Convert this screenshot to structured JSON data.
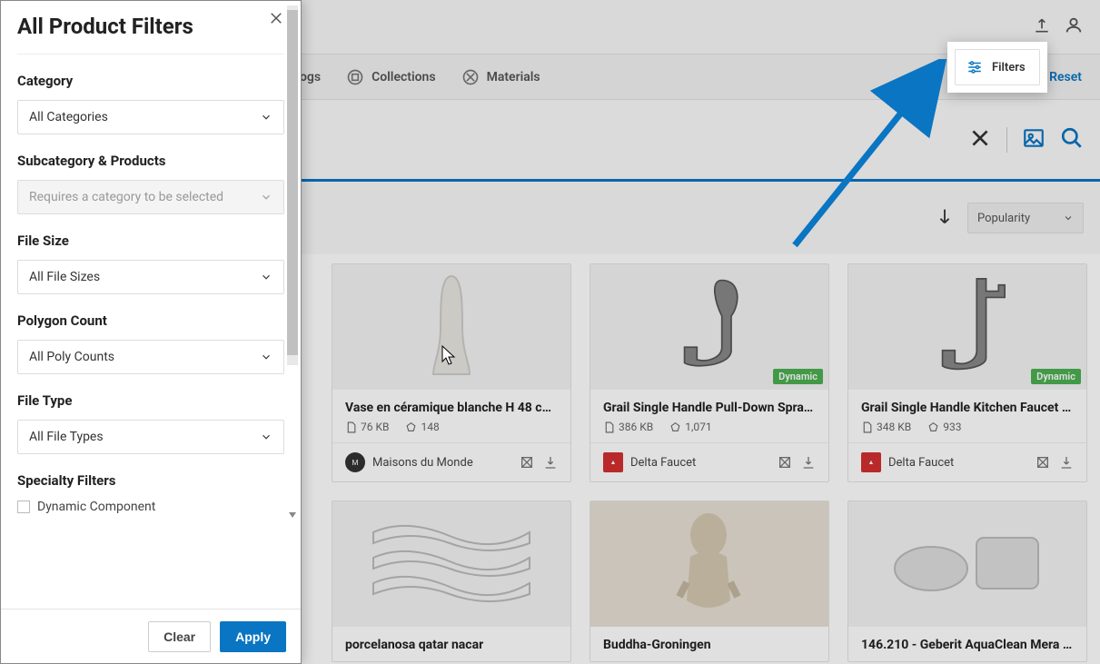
{
  "topbar": {},
  "tabs": {
    "catalogs_label": "ogs",
    "collections_label": "Collections",
    "materials_label": "Materials"
  },
  "reset_label": "Reset",
  "filters_button_label": "Filters",
  "sort": {
    "label": "Popularity"
  },
  "cards": [
    {
      "title": "Vase en céramique blanche H 48 cm …",
      "size": "76 KB",
      "poly": "148",
      "brand": "Maisons du Monde",
      "brand_kind": "round",
      "dynamic": false
    },
    {
      "title": "Grail Single Handle Pull-Down Spray …",
      "size": "386 KB",
      "poly": "1,071",
      "brand": "Delta Faucet",
      "brand_kind": "delta",
      "dynamic": true
    },
    {
      "title": "Grail Single Handle Kitchen Faucet b…",
      "size": "348 KB",
      "poly": "933",
      "brand": "Delta Faucet",
      "brand_kind": "delta",
      "dynamic": true
    }
  ],
  "cards_row2": [
    {
      "title": "porcelanosa qatar nacar"
    },
    {
      "title": "Buddha-Groningen"
    },
    {
      "title": "146.210 - Geberit AquaClean Mera Co…"
    }
  ],
  "badge_label": "Dynamic",
  "sidebar": {
    "title": "All Product Filters",
    "category_label": "Category",
    "category_value": "All Categories",
    "subcategory_label": "Subcategory & Products",
    "subcategory_placeholder": "Requires a category to be selected",
    "filesize_label": "File Size",
    "filesize_value": "All File Sizes",
    "polycount_label": "Polygon Count",
    "polycount_value": "All Poly Counts",
    "filetype_label": "File Type",
    "filetype_value": "All File Types",
    "specialty_label": "Specialty Filters",
    "dynamic_component_label": "Dynamic Component",
    "clear_label": "Clear",
    "apply_label": "Apply"
  }
}
